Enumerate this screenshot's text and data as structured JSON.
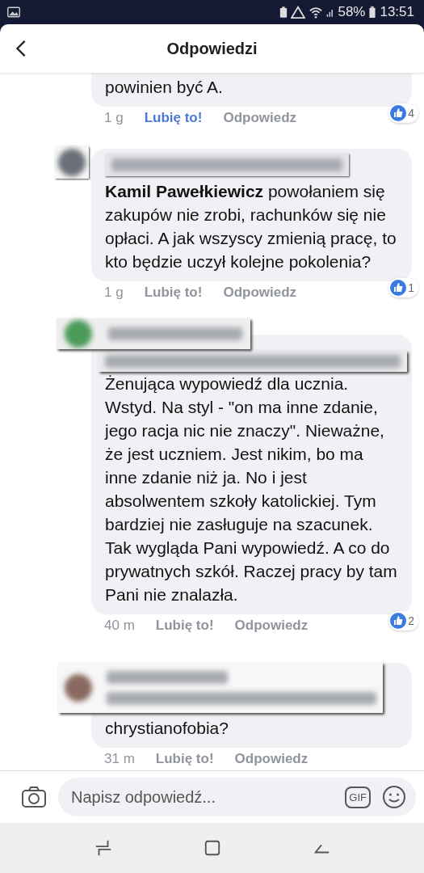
{
  "status_bar": {
    "battery": "58%",
    "time": "13:51"
  },
  "header": {
    "title": "Odpowiedzi"
  },
  "comments": [
    {
      "kind": "partial",
      "text": "powinien być A.",
      "time": "1 g",
      "like": "Lubię to!",
      "reply": "Odpowiedz",
      "liked": true,
      "reactions": "4"
    },
    {
      "kind": "redacted",
      "text": "**Kamil Pawełkiewicz** powołaniem się zakupów nie zrobi, rachunków się nie opłaci. A jak wszyscy zmienią pracę, to kto będzie uczył kolejne pokolenia?",
      "time": "1 g",
      "like": "Lubię to!",
      "reply": "Odpowiedz",
      "liked": false,
      "reactions": "1"
    },
    {
      "kind": "redacted_mention",
      "text": "Żenująca wypowiedź dla ucznia. Wstyd. Na styl - \"on ma inne zdanie, jego racja nic nie znaczy\". Nieważne, że jest uczniem. Jest nikim, bo ma inne zdanie niż ja. No i jest absolwentem szkoły katolickiej. Tym bardziej nie zasługuje na szacunek. Tak wygląda Pani wypowiedź. A co do prywatnych szkół. Raczej pracy by tam Pani nie znalazła.",
      "time": "40 m",
      "like": "Lubię to!",
      "reply": "Odpowiedz",
      "liked": false,
      "reactions": "2"
    },
    {
      "kind": "redacted_wide",
      "text": "chrystianofobia?",
      "time": "31 m",
      "like": "Lubię to!",
      "reply": "Odpowiedz",
      "liked": false
    }
  ],
  "composer": {
    "placeholder": "Napisz odpowiedź...",
    "gif": "GIF"
  }
}
